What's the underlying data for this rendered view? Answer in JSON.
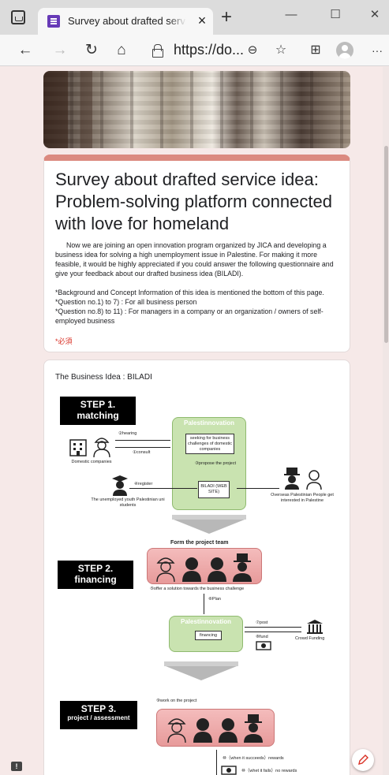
{
  "browser": {
    "tab_title": "Survey about drafted service idea",
    "tab_close": "×",
    "new_tab": "+",
    "minimize": "—",
    "maximize": "☐",
    "close": "✕",
    "address": "https://do...",
    "menu": "···"
  },
  "form": {
    "title": "Survey about drafted service idea: Problem-solving platform connected with love for homeland",
    "description": [
      "Now we are joining an open innovation program organized by JICA and developing a business idea for solving a high unemployment issue in Palestine. For making it more feasible, it would be highly appreciated if you could answer the following questionnaire and give your feedback about our drafted business idea (BILADI).",
      "*Background and Concept Information of this idea is mentioned the bottom of this page.",
      "*Question no.1) to 7) : For all business person",
      "*Question no.8) to 11) : For managers in a company or an organization / owners of self-employed business"
    ],
    "required_note": "*必須"
  },
  "idea": {
    "title": "The Business Idea : BILADI",
    "step1": {
      "line1": "STEP 1.",
      "line2": "matching"
    },
    "step2": {
      "line1": "STEP 2.",
      "line2": "financing"
    },
    "step3": {
      "line1": "STEP 3.",
      "line2": "project / assessment"
    },
    "palestinnovation": "Palestinnovation",
    "seeking": "seeking for business challenges of domestic companies",
    "biladi": "BILADI (WEB SITE)",
    "hearing": "②hearing",
    "consult": "①consult",
    "propose": "③propose the project",
    "register": "④register",
    "domestic": "Domestic companies",
    "youth": "The unemployed youth Palestinian uni students",
    "overseas": "Overseas Palestinian People get interested in Palestine",
    "form_team": "Form the project team",
    "offer": "⑤offer a solution towards the business challenge",
    "plan": "⑥Plan",
    "financing": "financing",
    "post": "⑦post",
    "fund": "⑧fund",
    "crowd": "Crowd Funding",
    "work": "⑨work on the project",
    "succeeds": "⑩（when it succeeds）rewards",
    "fails": "⑩（whet it fails）no rewards"
  },
  "colors": {
    "accent": "#db8a80",
    "background": "#f6e9e8",
    "required": "#d93025",
    "green_box": "#c9e3b0",
    "team_box": "#e79a9a"
  }
}
